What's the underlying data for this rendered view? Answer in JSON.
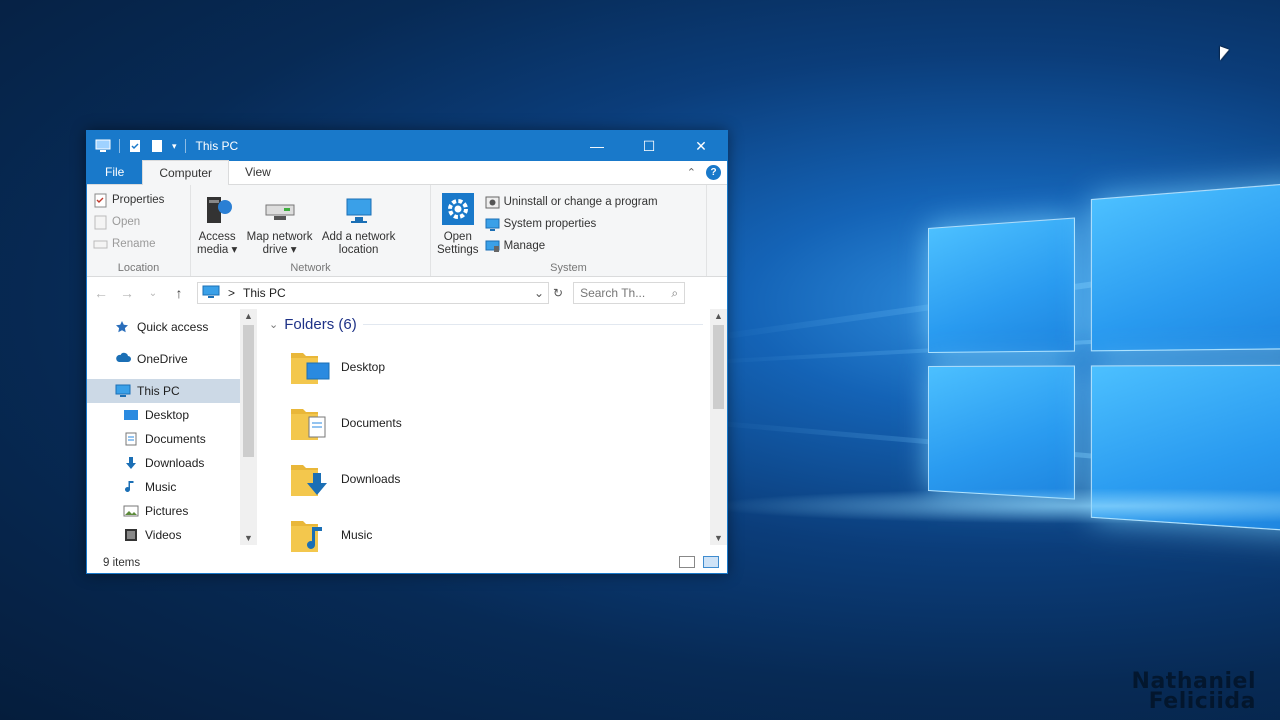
{
  "window": {
    "title": "This PC",
    "controls": {
      "minimize": "—",
      "maximize": "☐",
      "close": "✕"
    }
  },
  "ribbon": {
    "tabs": [
      "File",
      "Computer",
      "View"
    ],
    "active_tab": "Computer",
    "collapse_glyph": "⌃",
    "help_glyph": "?",
    "groups": {
      "location": {
        "label": "Location",
        "commands": [
          "Properties",
          "Open",
          "Rename"
        ]
      },
      "network": {
        "label": "Network",
        "access_media": [
          "Access",
          "media ▾"
        ],
        "map_drive": [
          "Map network",
          "drive ▾"
        ],
        "add_location": [
          "Add a network",
          "location"
        ]
      },
      "system": {
        "label": "System",
        "open_settings": [
          "Open",
          "Settings"
        ],
        "commands": [
          "Uninstall or change a program",
          "System properties",
          "Manage"
        ]
      }
    }
  },
  "address": {
    "path": "This PC",
    "separator": ">",
    "search_placeholder": "Search Th...",
    "back": "←",
    "forward": "→",
    "recent": "⌄",
    "up": "↑",
    "dropdown": "⌄",
    "refresh": "↻",
    "search_glyph": "⌕"
  },
  "nav": {
    "items": [
      {
        "label": "Quick access",
        "level": 0
      },
      {
        "label": "OneDrive",
        "level": 0
      },
      {
        "label": "This PC",
        "level": 0,
        "selected": true
      },
      {
        "label": "Desktop",
        "level": 1
      },
      {
        "label": "Documents",
        "level": 1
      },
      {
        "label": "Downloads",
        "level": 1
      },
      {
        "label": "Music",
        "level": 1
      },
      {
        "label": "Pictures",
        "level": 1
      },
      {
        "label": "Videos",
        "level": 1
      }
    ]
  },
  "files": {
    "group_title": "Folders (6)",
    "folders": [
      "Desktop",
      "Documents",
      "Downloads",
      "Music"
    ]
  },
  "status": {
    "item_count": "9 items"
  },
  "watermark": [
    "Nathaniel",
    "Feliciida"
  ],
  "colors": {
    "accent": "#1979ca",
    "folder": "#f3c74d",
    "group_header": "#1e3287"
  }
}
